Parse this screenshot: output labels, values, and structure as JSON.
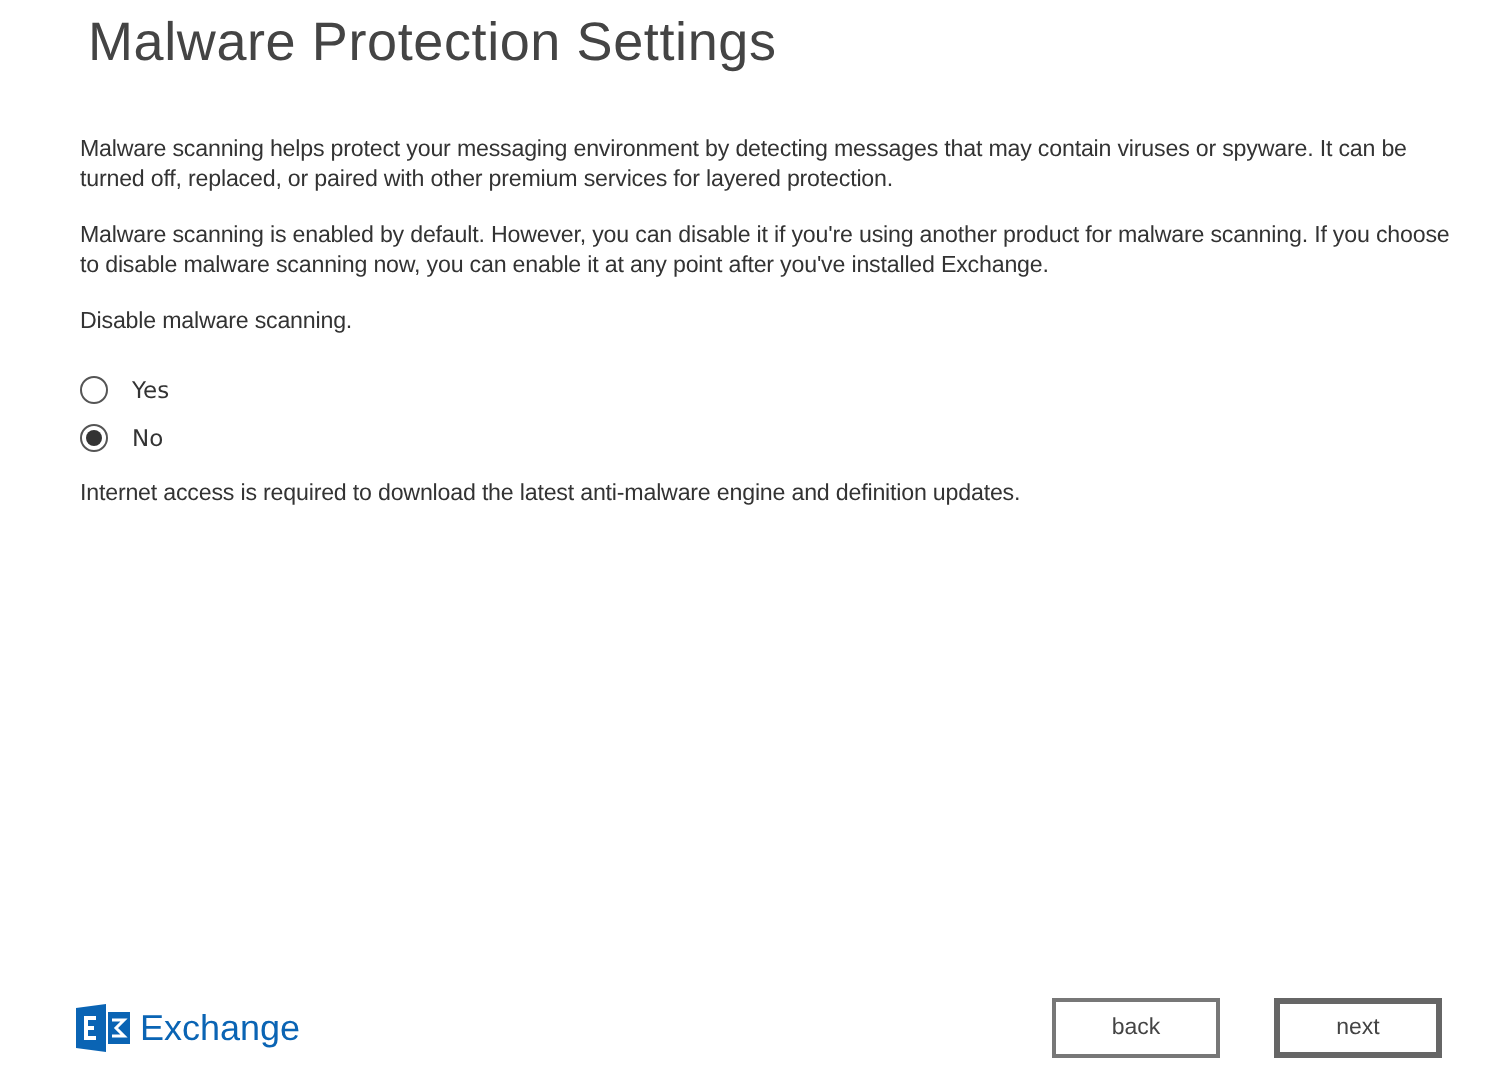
{
  "title": "Malware Protection Settings",
  "paragraphs": [
    "Malware scanning helps protect your messaging environment by detecting messages that may contain viruses or spyware. It can be turned off, replaced, or paired with other premium services for layered protection.",
    "Malware scanning is enabled by default. However, you can disable it if you're using another product for malware scanning. If you choose to disable malware scanning now, you can enable it at any point after you've installed Exchange."
  ],
  "question": "Disable malware scanning.",
  "options": [
    {
      "label": "Yes",
      "selected": false
    },
    {
      "label": "No",
      "selected": true
    }
  ],
  "note": "Internet access is required to download the latest anti-malware engine and definition updates.",
  "brand": "Exchange",
  "buttons": [
    {
      "label": "back",
      "kind": "secondary"
    },
    {
      "label": "next",
      "kind": "primary"
    }
  ]
}
